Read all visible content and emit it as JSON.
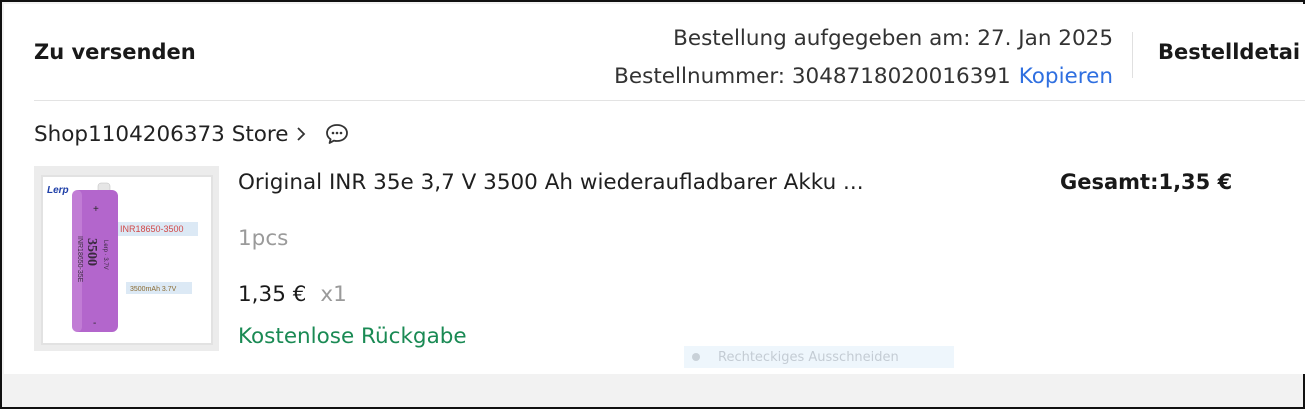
{
  "order": {
    "status": "Zu versenden",
    "date_line": "Bestellung aufgegeben am: 27. Jan 2025",
    "number_line": "Bestellnummer: 3048718020016391",
    "copy_label": "Kopieren",
    "details_label": "Bestelldetai"
  },
  "store": {
    "name": "Shop1104206373 Store",
    "chevron_icon": "chevron-right-icon",
    "chat_icon": "chat-bubble-icon"
  },
  "product": {
    "title": "Original INR 35e 3,7 V 3500 Ah wiederaufladbarer Akku ...",
    "variant": "1pcs",
    "price": "1,35 €",
    "quantity": "x1",
    "return_policy": "Kostenlose Rückgabe",
    "total": "Gesamt:1,35 €",
    "image": {
      "brand": "Lerp",
      "model_tag": "INR18650-3500",
      "capacity_tag": "3500mAh 3.7V",
      "cell_capacity": "3500",
      "cell_unit": "mAh",
      "cell_model": "INR18650-35E",
      "cell_voltage": "3.7V"
    }
  },
  "overlay": {
    "snip_label": "Rechteckiges Ausschneiden"
  },
  "colors": {
    "accent_link": "#2f6fe0",
    "return_green": "#1a8a54",
    "battery_purple": "#b366cc"
  }
}
